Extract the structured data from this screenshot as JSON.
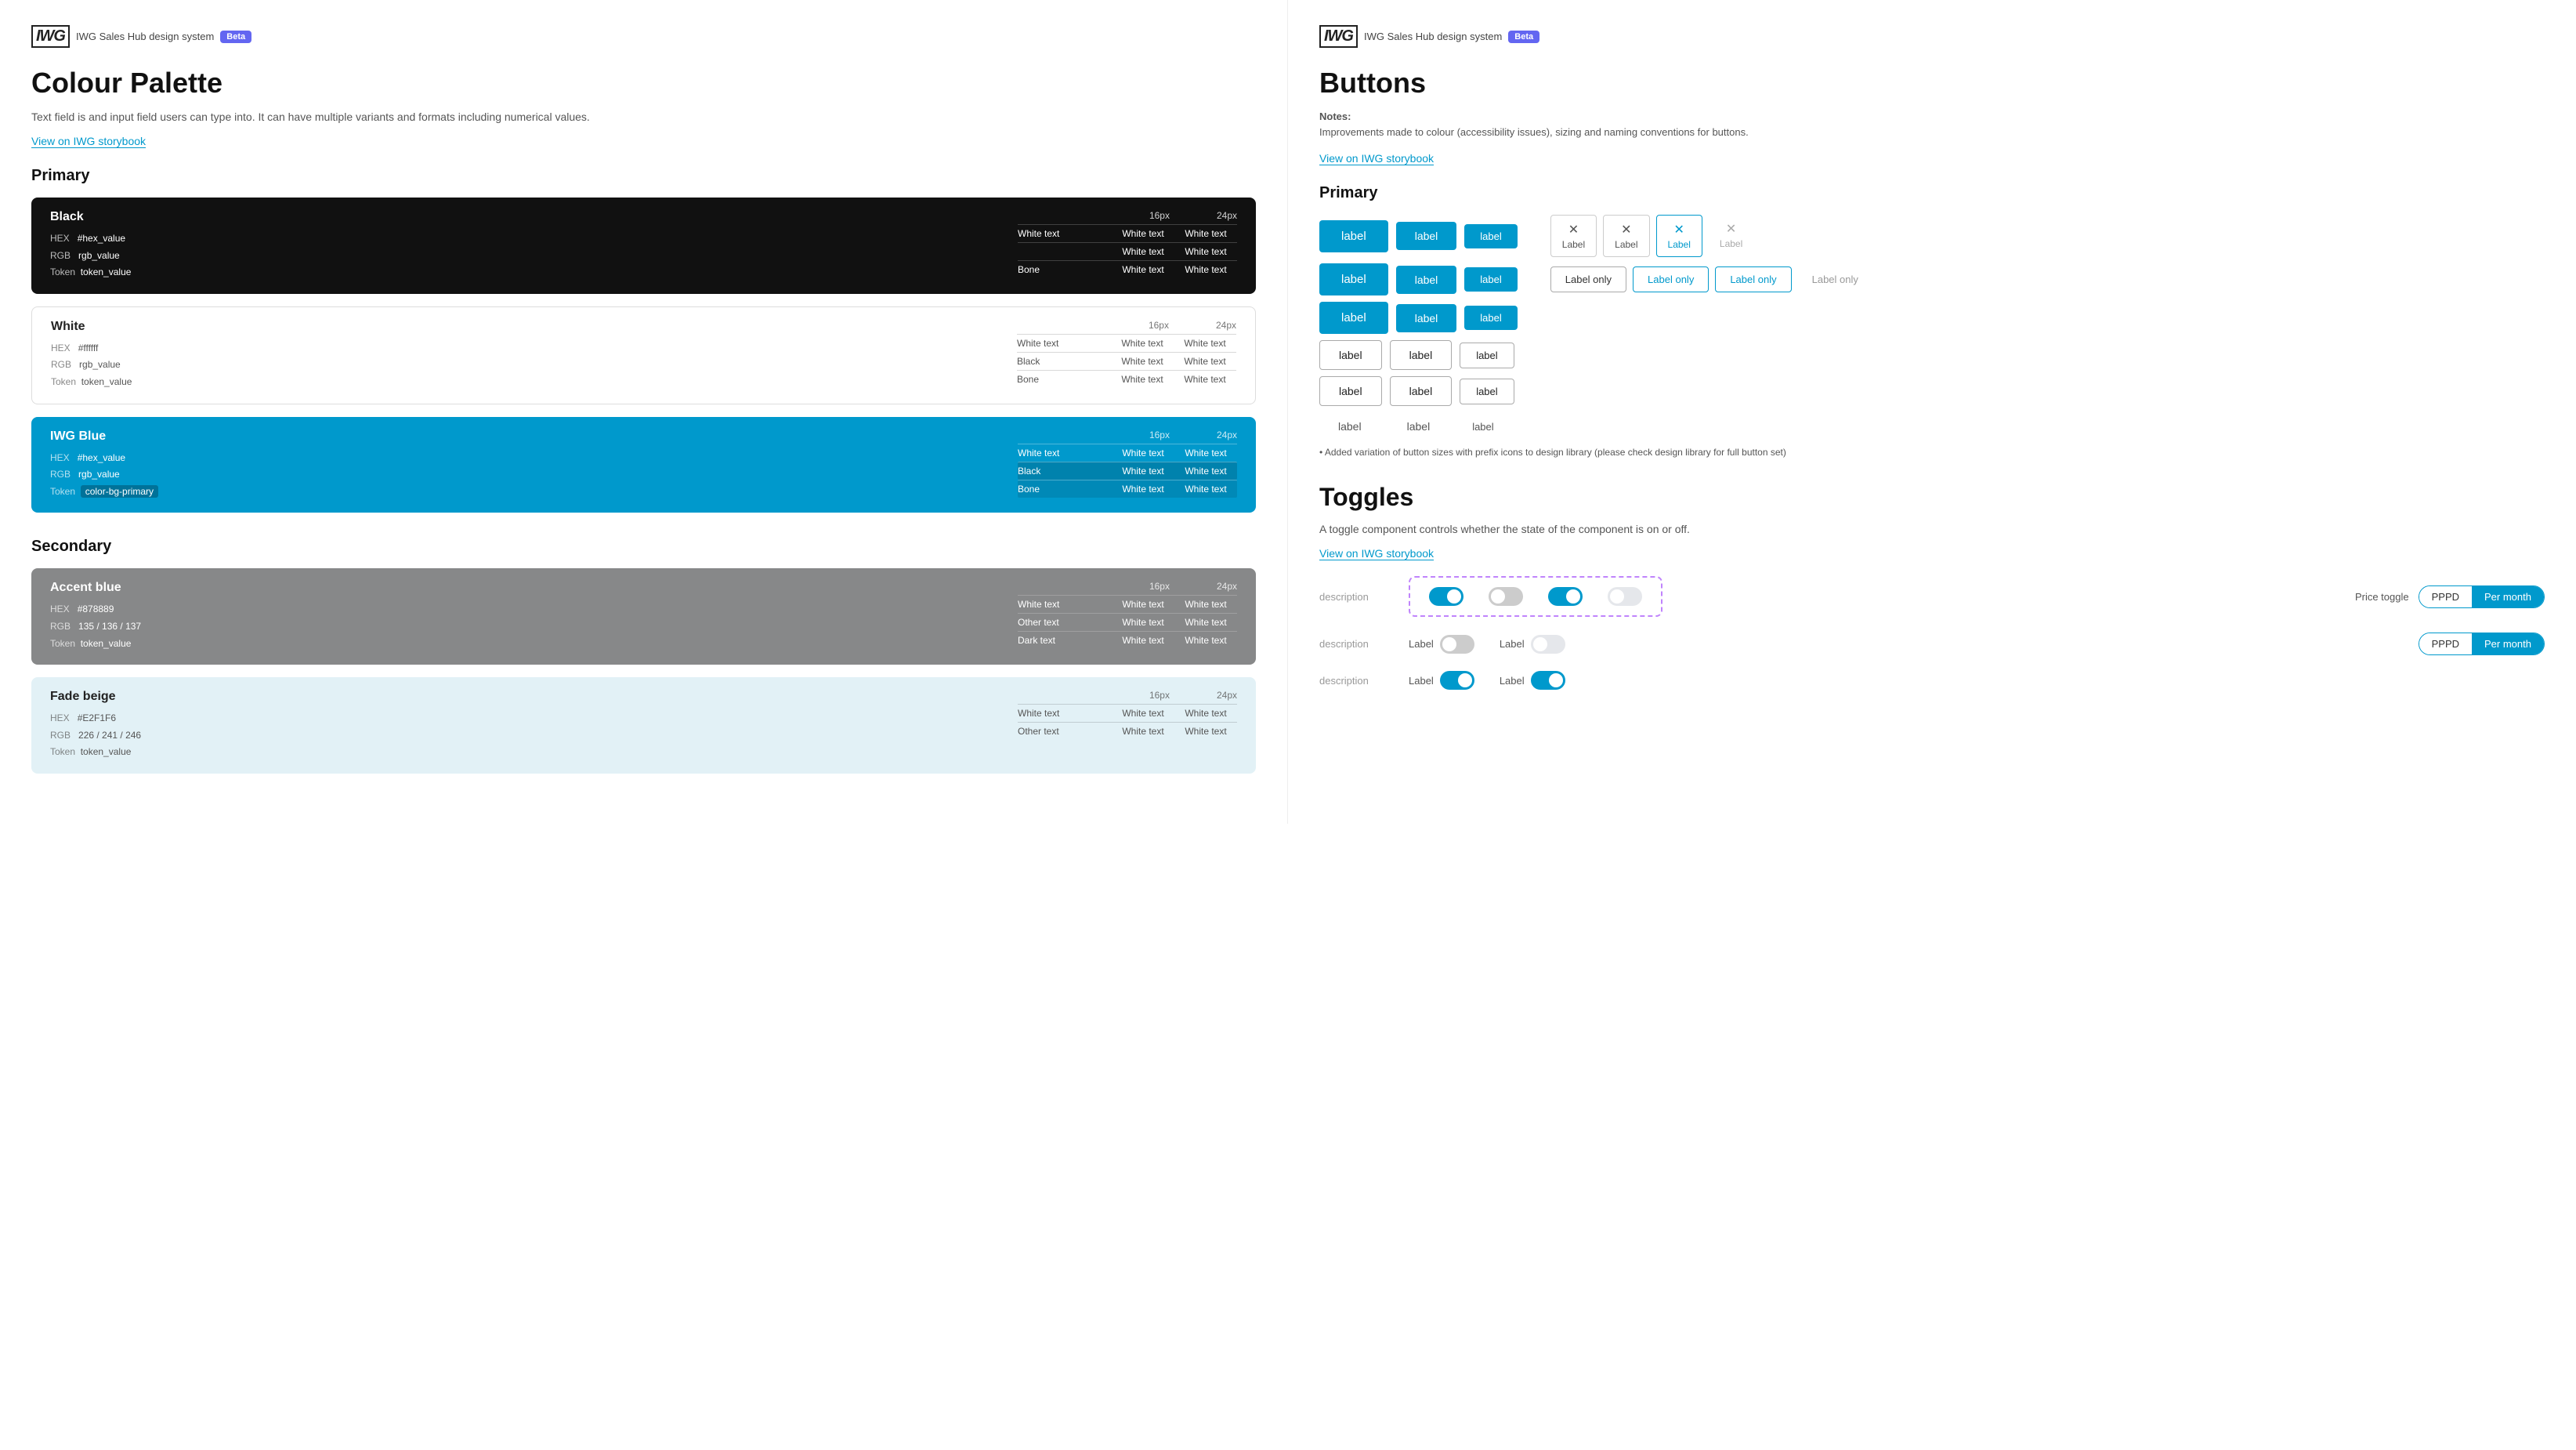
{
  "left": {
    "header": {
      "logo": "IWG",
      "title": "IWG Sales Hub design system",
      "badge": "Beta"
    },
    "page_title": "Colour Palette",
    "page_desc": "Text field is and input field users can type into. It can have multiple variants and formats including numerical values.",
    "storybook_link": "View on IWG storybook",
    "primary_section": "Primary",
    "colours": [
      {
        "name": "Black",
        "hex": "#hex_value",
        "rgb": "rgb_value",
        "token": "token_value",
        "type": "dark",
        "table": {
          "col1": "16px",
          "col2": "24px",
          "rows": [
            {
              "label": "White text",
              "v1": "White text",
              "v2": "White text"
            },
            {
              "label": "",
              "v1": "White text",
              "v2": "White text"
            },
            {
              "label": "Bone",
              "v1": "White text",
              "v2": "White text"
            }
          ]
        }
      },
      {
        "name": "White",
        "hex": "#ffffff",
        "rgb": "rgb_value",
        "token": "token_value",
        "type": "white",
        "table": {
          "col1": "16px",
          "col2": "24px",
          "rows": [
            {
              "label": "White text",
              "v1": "White text",
              "v2": "White text"
            },
            {
              "label": "Black",
              "v1": "White text",
              "v2": "White text"
            },
            {
              "label": "Bone",
              "v1": "White text",
              "v2": "White text"
            }
          ]
        }
      },
      {
        "name": "IWG Blue",
        "hex": "#hex_value",
        "rgb": "rgb_value",
        "token": "color-bg-primary",
        "type": "blue",
        "table": {
          "col1": "16px",
          "col2": "24px",
          "rows": [
            {
              "label": "White text",
              "v1": "White text",
              "v2": "White text"
            },
            {
              "label": "Black",
              "v1": "White text",
              "v2": "White text"
            },
            {
              "label": "Bone",
              "v1": "White text",
              "v2": "White text"
            }
          ]
        }
      }
    ],
    "secondary_section": "Secondary",
    "secondary_colours": [
      {
        "name": "Accent blue",
        "hex": "#878889",
        "rgb": "135 / 136 / 137",
        "token": "token_value",
        "type": "accent",
        "table": {
          "col1": "16px",
          "col2": "24px",
          "rows": [
            {
              "label": "White text",
              "v1": "White text",
              "v2": "White text"
            },
            {
              "label": "Other text",
              "v1": "White text",
              "v2": "White text"
            },
            {
              "label": "Dark text",
              "v1": "White text",
              "v2": "White text"
            }
          ]
        }
      },
      {
        "name": "Fade beige",
        "hex": "#E2F1F6",
        "rgb": "226 / 241 / 246",
        "token": "token_value",
        "type": "fade",
        "table": {
          "col1": "16px",
          "col2": "24px",
          "rows": [
            {
              "label": "White text",
              "v1": "White text",
              "v2": "White text"
            },
            {
              "label": "Other text",
              "v1": "White text",
              "v2": "White text"
            }
          ]
        }
      }
    ]
  },
  "right": {
    "header": {
      "logo": "IWG",
      "title": "IWG Sales Hub design system",
      "badge": "Beta"
    },
    "page_title": "Buttons",
    "notes_label": "Notes:",
    "notes_text": "Improvements made to colour (accessibility issues), sizing  and naming conventions for buttons.",
    "storybook_link": "View on IWG storybook",
    "primary_section": "Primary",
    "buttons": {
      "primary_labels": [
        "label",
        "label",
        "label"
      ],
      "secondary_labels": [
        "label",
        "label",
        "label"
      ],
      "tertiary_labels": [
        "label",
        "label",
        "label"
      ],
      "outline_labels": [
        "label",
        "label",
        "label"
      ],
      "outline2_labels": [
        "label",
        "label",
        "label"
      ],
      "outline3_labels": [
        "label",
        "label",
        "label"
      ],
      "icon_labels": [
        "Label",
        "Label",
        "Label",
        "Label"
      ],
      "label_only": [
        "Label only",
        "Label only",
        "Label only",
        "Label only"
      ]
    },
    "btn_note": "• Added variation of button sizes with prefix icons to design library (please check design library for full button set)",
    "toggles_title": "Toggles",
    "toggles_desc": "A toggle component controls whether the state of the component is on or off.",
    "toggles_storybook": "View on IWG storybook",
    "toggle_rows": [
      {
        "desc": "description"
      },
      {
        "desc": "description"
      },
      {
        "desc": "description"
      }
    ],
    "price_toggle": {
      "label": "Price toggle",
      "pppd": "PPPD",
      "per_month": "Per month"
    },
    "price_toggle2": {
      "pppd": "PPPD",
      "per_month": "Per month"
    },
    "toggle_with_labels": [
      {
        "label1": "Label",
        "label2": "Label"
      },
      {
        "label1": "Label",
        "label2": "Label"
      }
    ]
  }
}
